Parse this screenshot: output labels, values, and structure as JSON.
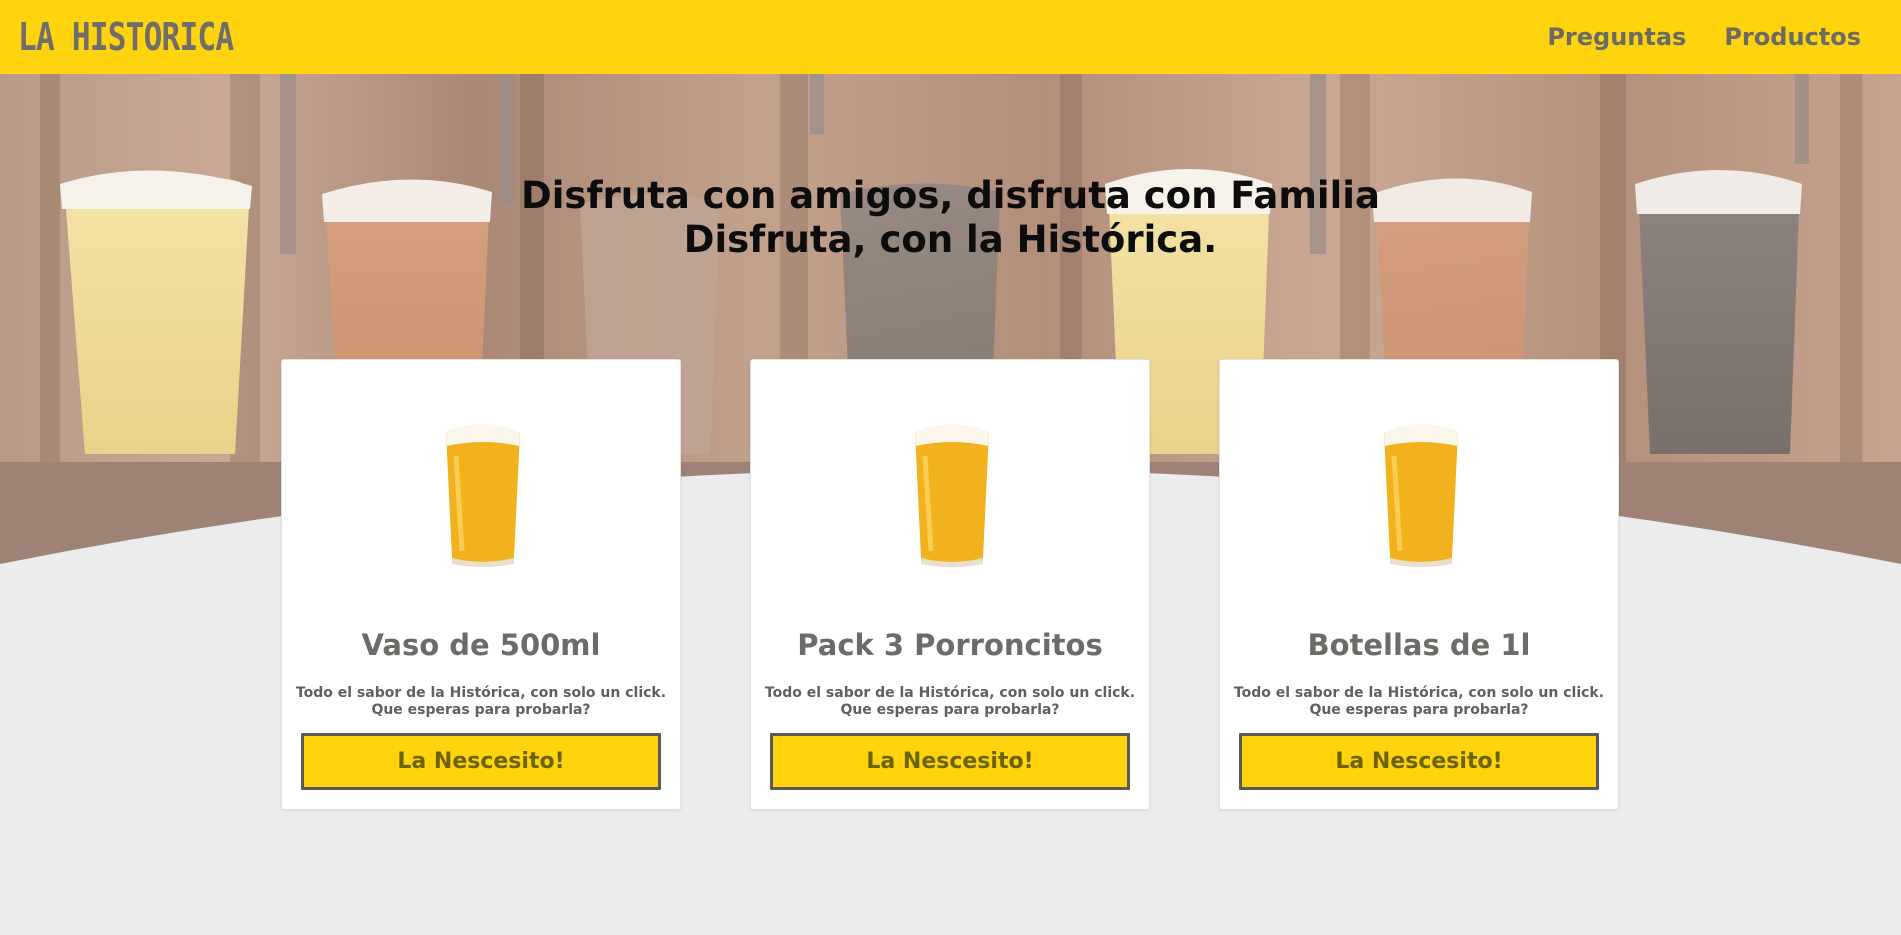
{
  "navbar": {
    "logo": "LA HISTORICA",
    "links": [
      "Preguntas",
      "Productos"
    ]
  },
  "hero": {
    "line1": "Disfruta con amigos, disfruta con Familia",
    "line2": "Disfruta, con la Histórica."
  },
  "products": [
    {
      "title": "Vaso de 500ml",
      "desc1": "Todo el sabor de la Histórica, con solo un click.",
      "desc2": "Que esperas para probarla?",
      "button": "La Nescesito!"
    },
    {
      "title": "Pack 3 Porroncitos",
      "desc1": "Todo el sabor de la Histórica, con solo un click.",
      "desc2": "Que esperas para probarla?",
      "button": "La Nescesito!"
    },
    {
      "title": "Botellas de 1l",
      "desc1": "Todo el sabor de la Histórica, con solo un click.",
      "desc2": "Que esperas para probarla?",
      "button": "La Nescesito!"
    }
  ],
  "colors": {
    "accent": "#ffd30e",
    "text_gray": "#6c6b67",
    "background": "#ececec"
  }
}
